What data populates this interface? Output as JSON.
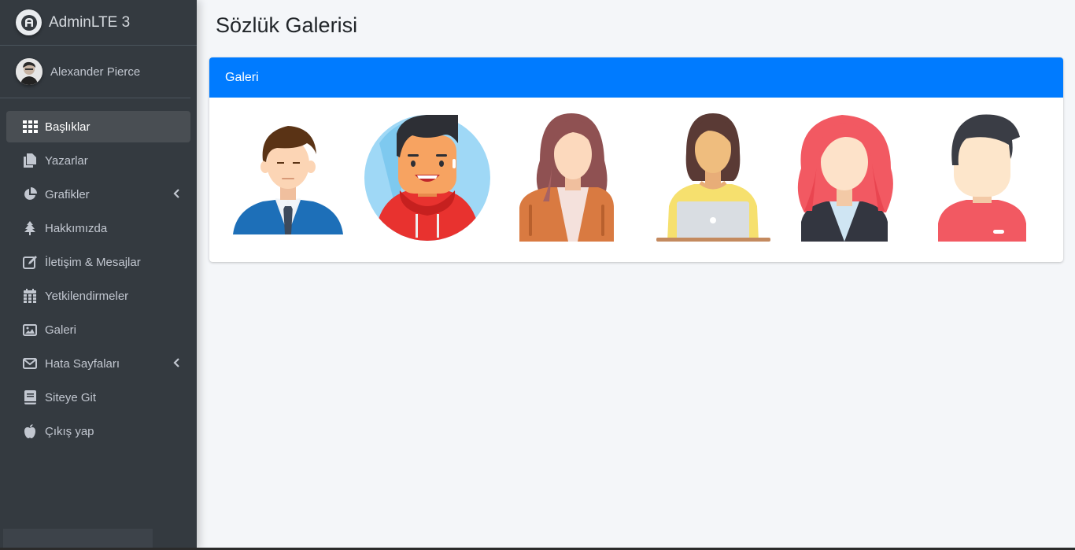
{
  "brand": {
    "name": "AdminLTE 3",
    "logo_icon": "adminlte-logo-icon"
  },
  "user": {
    "name": "Alexander Pierce",
    "avatar_icon": "user-avatar"
  },
  "sidebar": {
    "items": [
      {
        "label": "Başlıklar",
        "icon": "th-grid-icon",
        "active": true
      },
      {
        "label": "Yazarlar",
        "icon": "copy-icon"
      },
      {
        "label": "Grafikler",
        "icon": "chart-pie-icon",
        "has_submenu": true
      },
      {
        "label": "Hakkımızda",
        "icon": "tree-icon"
      },
      {
        "label": "İletişim & Mesajlar",
        "icon": "edit-icon"
      },
      {
        "label": "Yetkilendirmeler",
        "icon": "calendar-icon"
      },
      {
        "label": "Galeri",
        "icon": "image-icon"
      },
      {
        "label": "Hata Sayfaları",
        "icon": "envelope-icon",
        "has_submenu": true
      },
      {
        "label": "Siteye Git",
        "icon": "book-icon"
      },
      {
        "label": "Çıkış yap",
        "icon": "apple-icon"
      }
    ]
  },
  "page": {
    "title": "Sözlük Galerisi"
  },
  "card": {
    "title": "Galeri"
  },
  "gallery": {
    "images": [
      "businessman-avatar",
      "smiling-man-hoodie-avatar",
      "woman-brown-hair-avatar",
      "woman-laptop-avatar",
      "woman-red-hair-avatar",
      "man-red-shirt-avatar"
    ]
  },
  "colors": {
    "primary": "#007bff",
    "sidebar_bg": "#343a40",
    "page_bg": "#f4f6f9"
  }
}
